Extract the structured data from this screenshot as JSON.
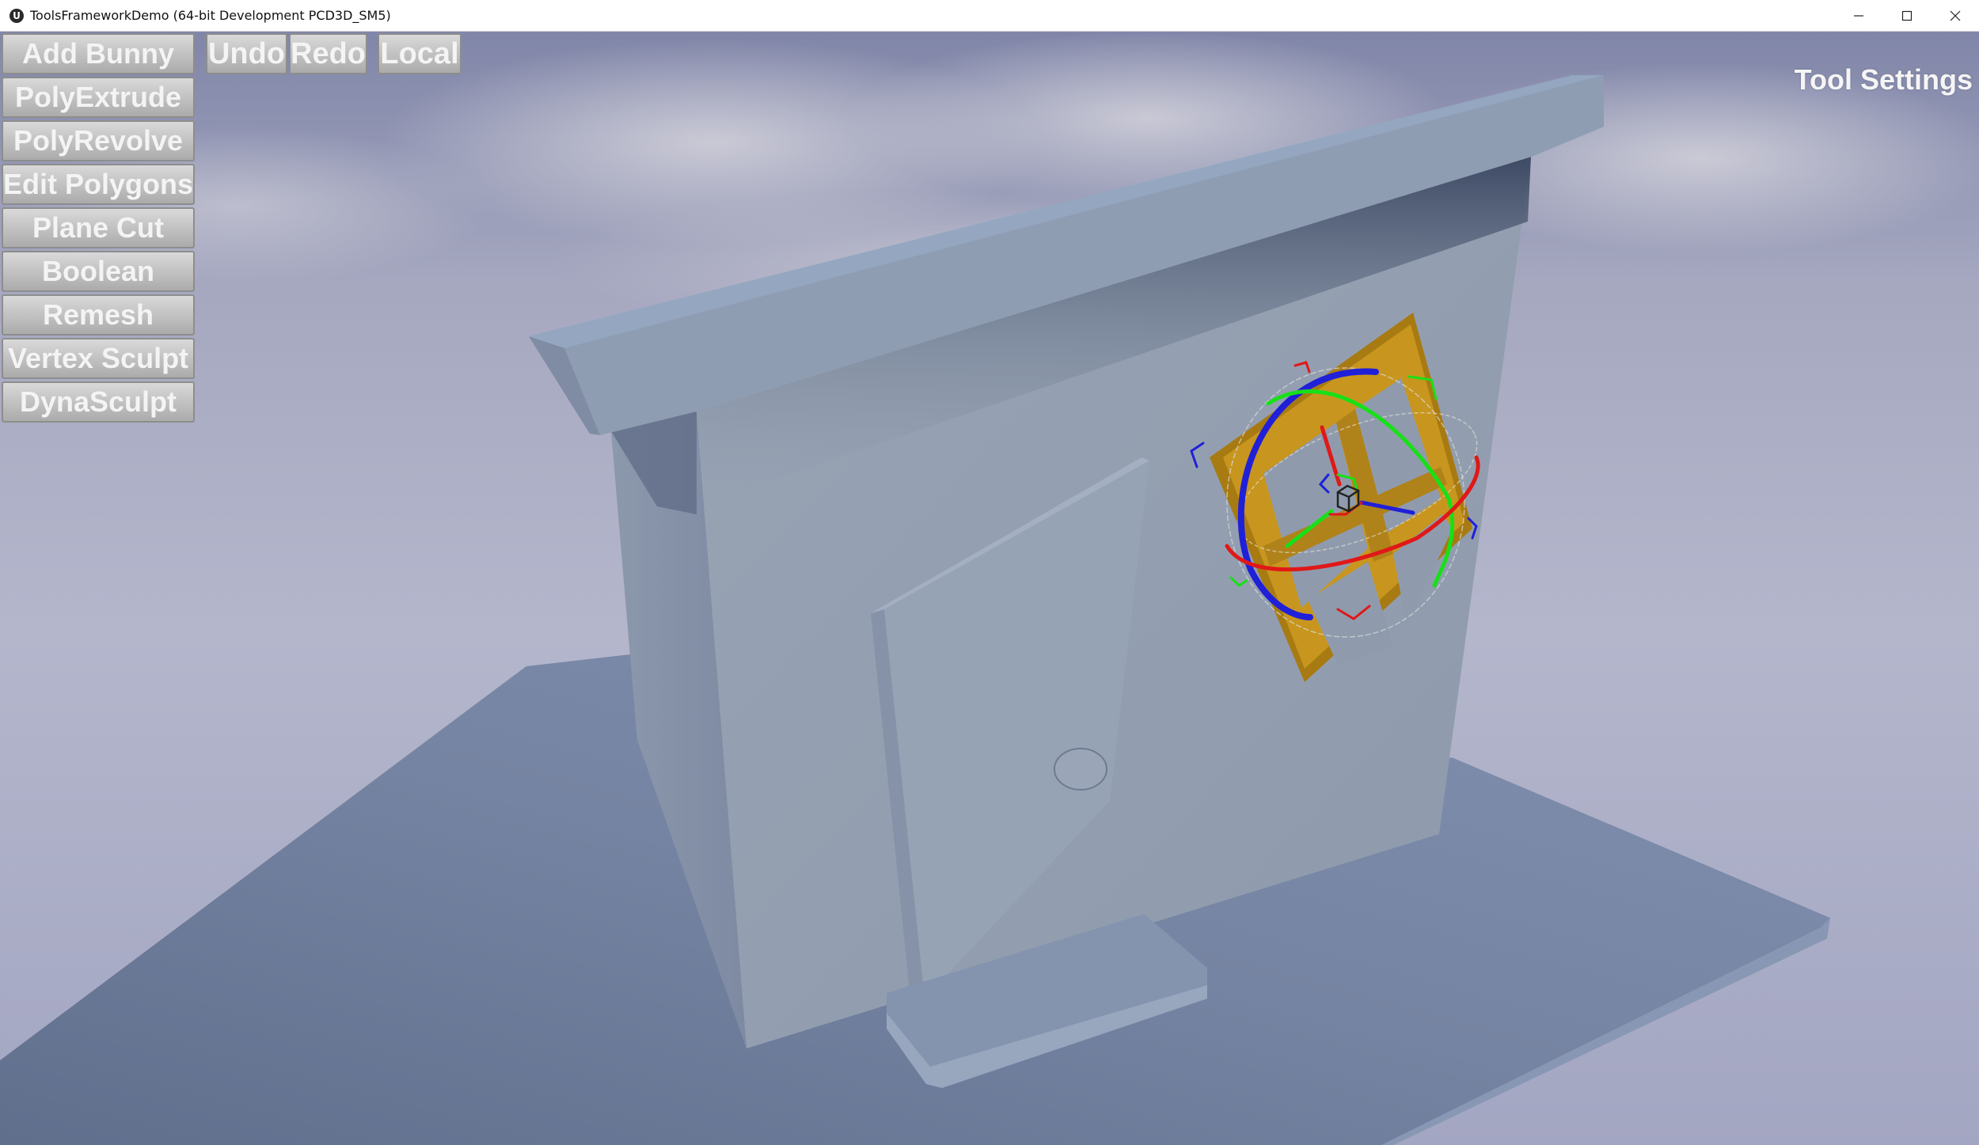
{
  "window": {
    "title": "ToolsFrameworkDemo (64-bit Development PCD3D_SM5)",
    "app_icon": "unreal-engine-logo-icon",
    "controls": [
      "minimize-icon",
      "maximize-icon",
      "close-icon"
    ]
  },
  "toolbar_left": {
    "buttons": [
      {
        "label": "Add Bunny"
      },
      {
        "label": "PolyExtrude"
      },
      {
        "label": "PolyRevolve"
      },
      {
        "label": "Edit Polygons"
      },
      {
        "label": "Plane Cut"
      },
      {
        "label": "Boolean"
      },
      {
        "label": "Remesh"
      },
      {
        "label": "Vertex Sculpt"
      },
      {
        "label": "DynaSculpt"
      }
    ]
  },
  "toolbar_top": {
    "undo_label": "Undo",
    "redo_label": "Redo",
    "coord_space_label": "Local"
  },
  "panel": {
    "tool_settings_label": "Tool Settings"
  },
  "scene": {
    "objects": [
      "ground-plane",
      "house",
      "roof",
      "door",
      "door-knob",
      "door-step",
      "window-frame",
      "transform-gizmo"
    ],
    "colors": {
      "sky": "#a9abc6",
      "floor": "#7282a0",
      "wall": "#94a0b0",
      "roof": "#8e9cb2",
      "window_frame": "#c8961e",
      "gizmo_x": "#e01818",
      "gizmo_y": "#18e018",
      "gizmo_z": "#2020e0"
    }
  }
}
